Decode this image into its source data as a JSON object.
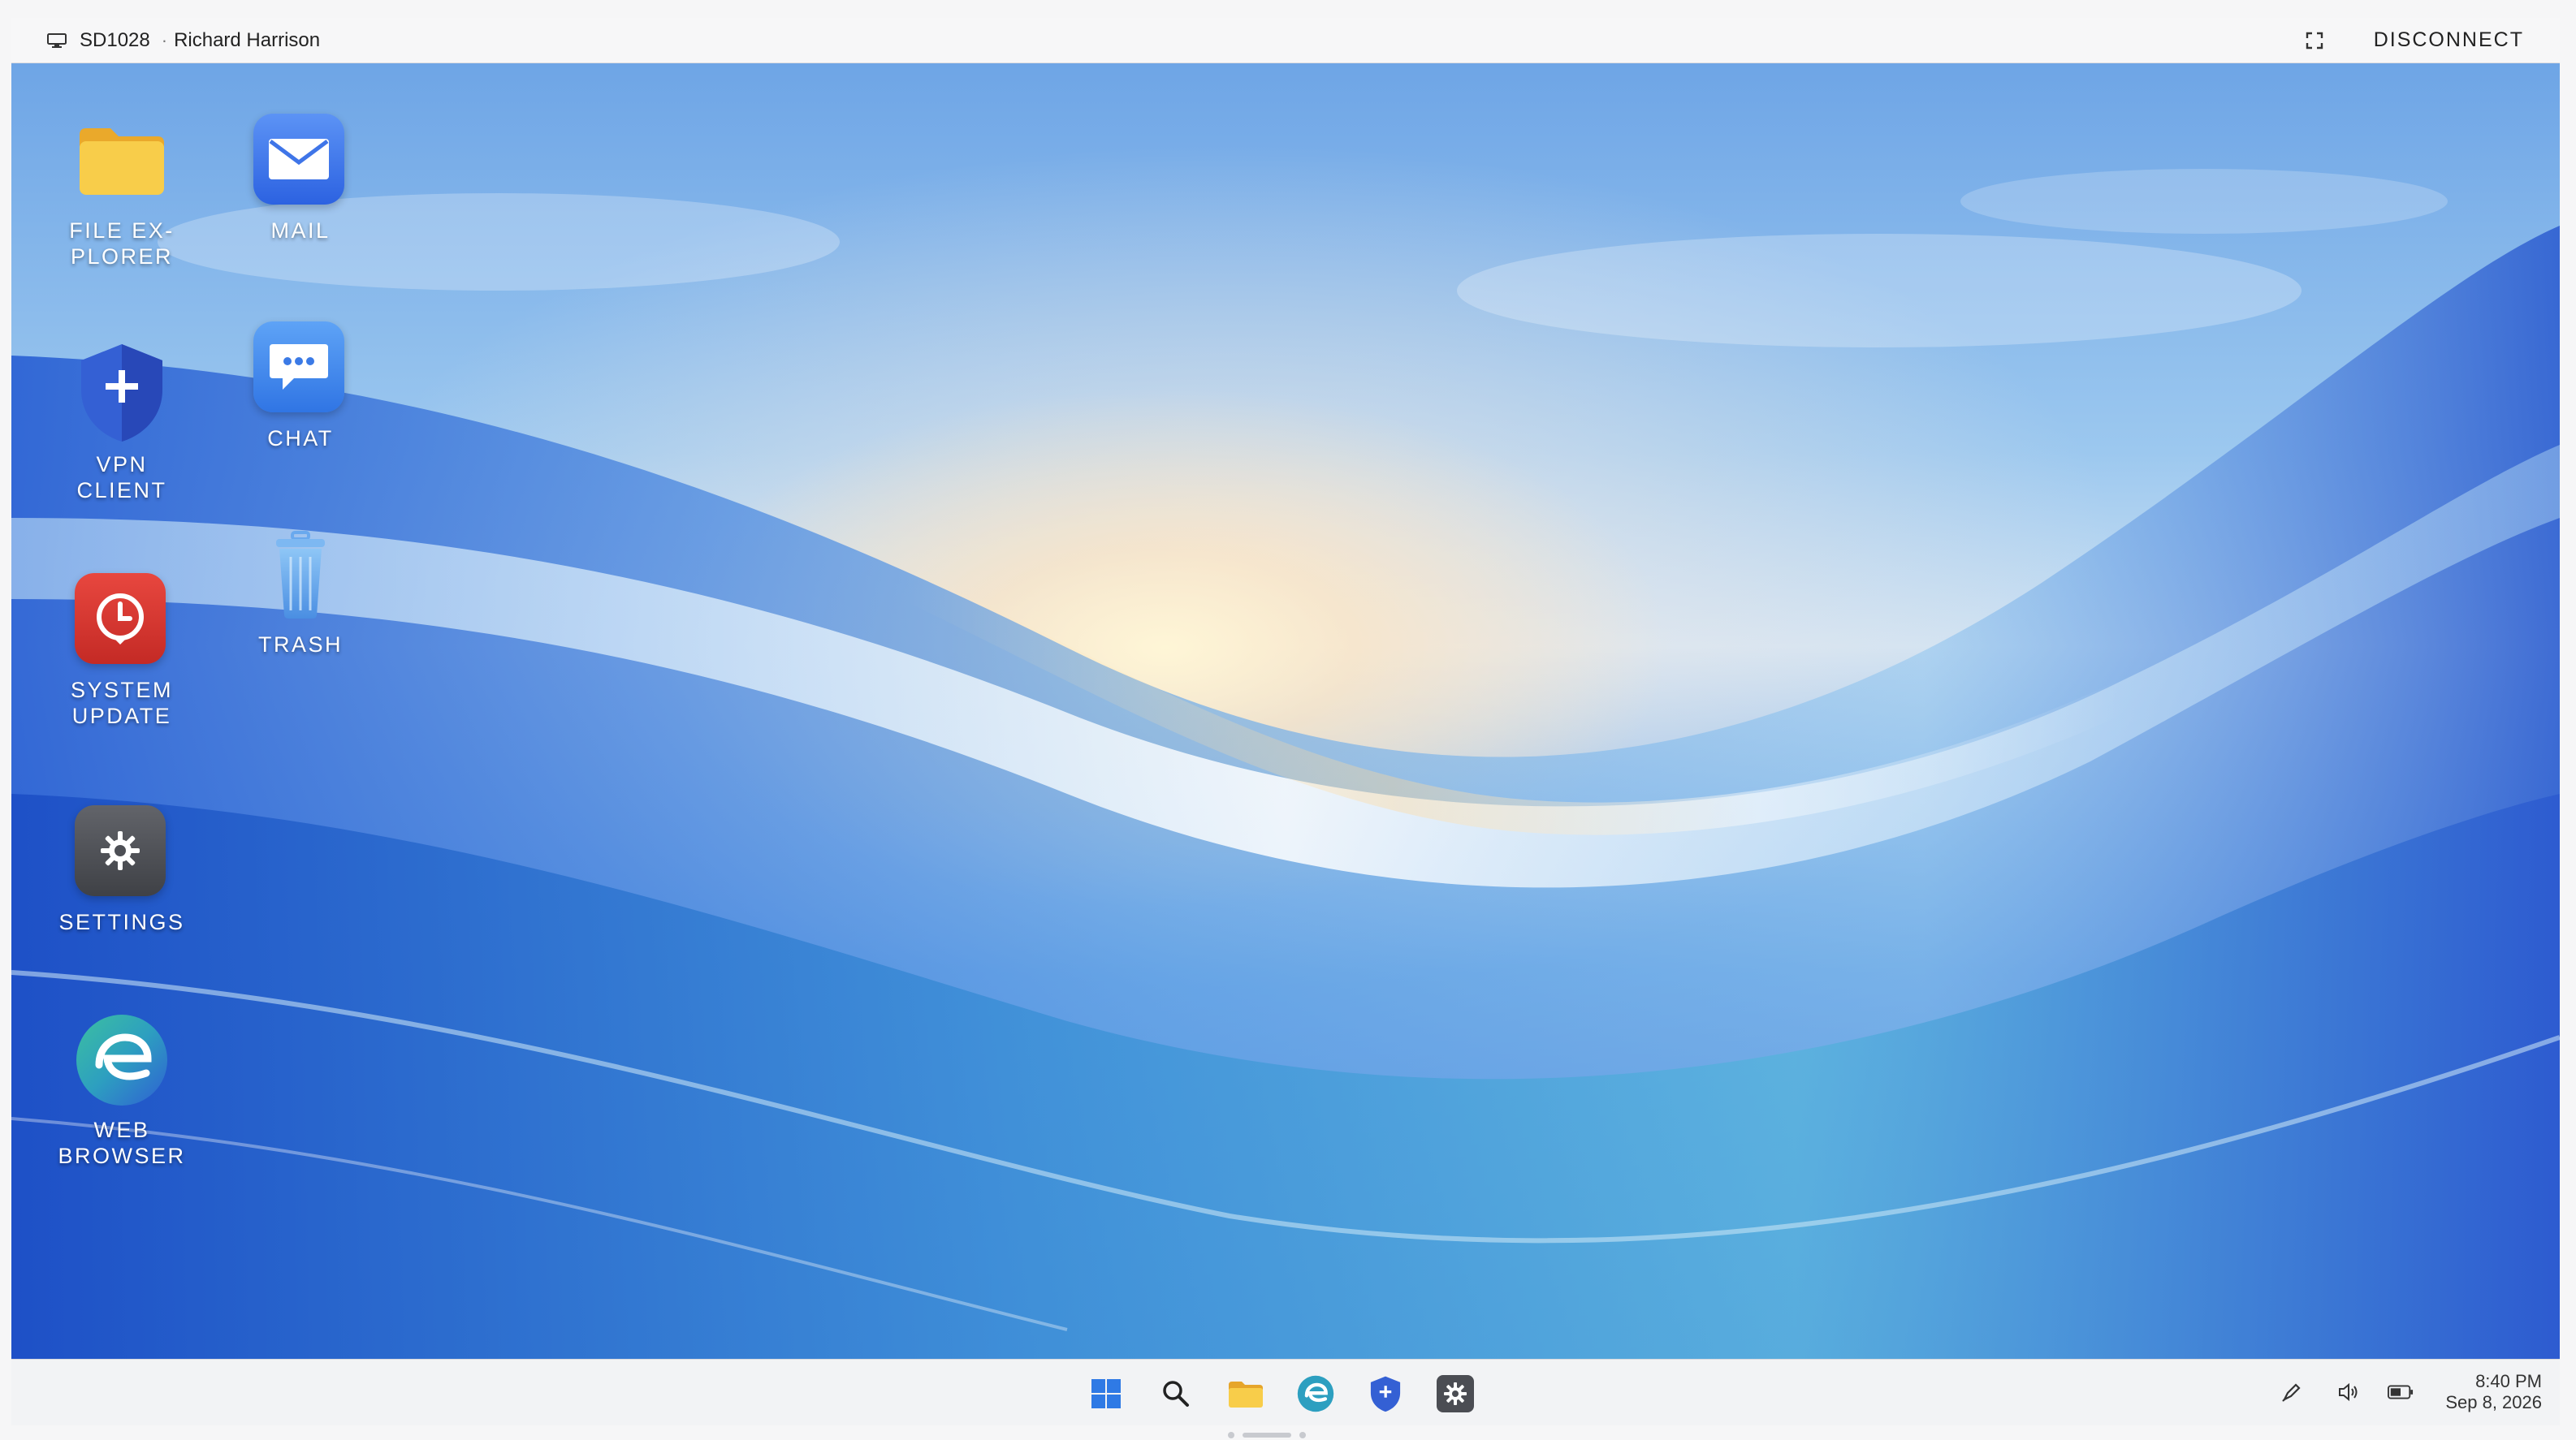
{
  "session": {
    "id": "SD1028",
    "separator": "·",
    "user": "Richard Harrison",
    "disconnect_label": "DISCONNECT",
    "icons": {
      "monitor": "monitor-icon",
      "fullscreen": "fullscreen-icon"
    }
  },
  "desktop": {
    "icons": [
      {
        "label": "FILE EX-\nPLORER",
        "icon": "folder-icon"
      },
      {
        "label": "MAIL",
        "icon": "mail-icon"
      },
      {
        "label": "VPN\nCLIENT",
        "icon": "shield-icon"
      },
      {
        "label": "CHAT",
        "icon": "chat-icon"
      },
      {
        "label": "SYSTEM\nUPDATE",
        "icon": "clock-icon"
      },
      {
        "label": "TRASH",
        "icon": "trash-icon"
      },
      {
        "label": "SETTINGS",
        "icon": "gear-icon"
      },
      {
        "label": "WEB\nBROWSER",
        "icon": "browser-icon"
      }
    ]
  },
  "taskbar": {
    "items": [
      "start-icon",
      "search-icon",
      "folder-icon",
      "browser-icon",
      "vpn-shield-icon",
      "settings-icon"
    ],
    "tray": [
      "pen-icon",
      "volume-icon",
      "battery-icon"
    ],
    "time": "8:40 PM",
    "date": "Sep 8, 2026"
  },
  "colors": {
    "folder": "#f8c843",
    "mail": "#3b78ee",
    "vpn": "#2f5bd1",
    "chat": "#3a86ee",
    "update": "#d9352d",
    "settings": "#505258",
    "browser": "#2d9ab8"
  }
}
